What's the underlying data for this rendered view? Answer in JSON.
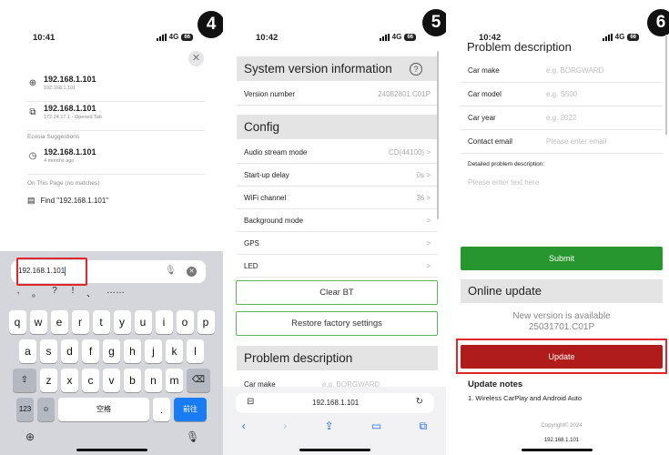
{
  "badges": [
    "4",
    "5",
    "6"
  ],
  "phone1": {
    "time": "10:41",
    "network": "4G",
    "battery": "66",
    "suggestions": [
      {
        "icon": "globe-icon",
        "glyph": "⊕",
        "title": "192.168.1.101",
        "subtitle": "192.168.1.101"
      },
      {
        "icon": "tabs-icon",
        "glyph": "⧉",
        "title": "192.168.1.101",
        "subtitle": "172.24.17.1 - Opened Tab"
      }
    ],
    "ecosia_header": "Ecosia Suggestions",
    "ecosia_item": {
      "icon": "history-icon",
      "glyph": "◷",
      "title": "192.168.1.101",
      "subtitle": "4 months ago"
    },
    "on_page_header": "On This Page (no matches)",
    "find_text": "Find \"192.168.1.101\"",
    "url_input": "192.168.1.101",
    "punct": [
      ",",
      "。",
      "?",
      "!",
      "、",
      "……"
    ],
    "keys_row1": [
      "q",
      "w",
      "e",
      "r",
      "t",
      "y",
      "u",
      "i",
      "o",
      "p"
    ],
    "keys_row2": [
      "a",
      "s",
      "d",
      "f",
      "g",
      "h",
      "j",
      "k",
      "l"
    ],
    "keys_row3": [
      "z",
      "x",
      "c",
      "v",
      "b",
      "n",
      "m"
    ],
    "key_123": "123",
    "key_space": "空格",
    "key_dot": ".",
    "key_go": "前往"
  },
  "phone2": {
    "time": "10:42",
    "sys_header": "System version information",
    "version_label": "Version number",
    "version_value": "24082801.C01P",
    "config_header": "Config",
    "config_rows": [
      {
        "label": "Audio stream mode",
        "value": "CD(44100) >"
      },
      {
        "label": "Start-up delay",
        "value": "0s >"
      },
      {
        "label": "WiFi channel",
        "value": "36 >"
      },
      {
        "label": "Background mode",
        "value": ">"
      },
      {
        "label": "GPS",
        "value": ">"
      },
      {
        "label": "LED",
        "value": ">"
      }
    ],
    "clear_bt": "Clear BT",
    "restore": "Restore factory settings",
    "problem_header": "Problem description",
    "car_make_label": "Car make",
    "car_make_placeholder": "e.g. BORGWARD",
    "url": "192.168.1.101"
  },
  "phone3": {
    "time": "10:42",
    "problem_header": "Problem description",
    "fields": [
      {
        "label": "Car make",
        "placeholder": "e.g. BORGWARD"
      },
      {
        "label": "Car model",
        "placeholder": "e.g. S500"
      },
      {
        "label": "Car year",
        "placeholder": "e.g. 2022"
      },
      {
        "label": "Contact email",
        "placeholder": "Please enter email"
      }
    ],
    "detail_label": "Detailed problem description:",
    "detail_placeholder": "Please enter text here",
    "submit": "Submit",
    "online_update": "Online update",
    "new_version_line1": "New version is available",
    "new_version_line2": "25031701.C01P",
    "update": "Update",
    "notes_header": "Update notes",
    "notes_item": "1. Wireless CarPlay and Android Auto",
    "copyright": "Copyright© 2024",
    "url": "192.168.1.101"
  },
  "colors": {
    "green": "#27962f",
    "red_button": "#b01c1c",
    "highlight": "#e0262b",
    "ios_blue": "#1a7cf5"
  }
}
